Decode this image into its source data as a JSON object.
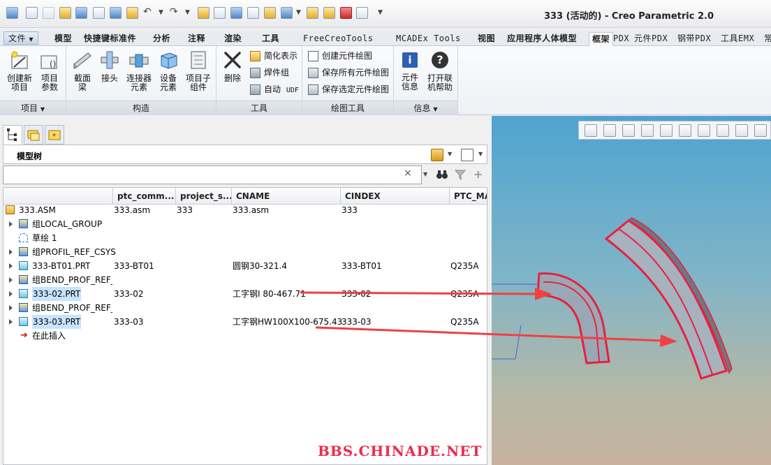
{
  "window": {
    "title": "333 (活动的) - Creo Parametric 2.0"
  },
  "menu_tabs": [
    {
      "label": "文件"
    },
    {
      "label": "模型"
    },
    {
      "label": "快捷键标准件"
    },
    {
      "label": "分析"
    },
    {
      "label": "注释"
    },
    {
      "label": "渲染"
    },
    {
      "label": "工具"
    },
    {
      "label": "FreeCreoTools"
    },
    {
      "label": "MCADEx Tools"
    },
    {
      "label": "视图"
    },
    {
      "label": "应用程序人体模型"
    },
    {
      "label": "框架"
    },
    {
      "label": "PDX"
    },
    {
      "label": "元件PDX"
    },
    {
      "label": "钢带PDX"
    },
    {
      "label": "工具EMX"
    },
    {
      "label": "常"
    }
  ],
  "ribbon": {
    "groups": [
      {
        "label": "项目"
      },
      {
        "label": "构造"
      },
      {
        "label": "工具"
      },
      {
        "label": "绘图工具"
      },
      {
        "label": "信息"
      }
    ],
    "project_buttons": [
      {
        "line1": "创建新",
        "line2": "项目"
      },
      {
        "line1": "项目",
        "line2": "参数"
      }
    ],
    "construct_buttons": [
      {
        "line1": "截面",
        "line2": "梁"
      },
      {
        "line1": "接头",
        "line2": ""
      },
      {
        "line1": "连接器",
        "line2": "元素"
      },
      {
        "line1": "设备",
        "line2": "元素"
      },
      {
        "line1": "项目子",
        "line2": "组件"
      }
    ],
    "delete_button": "删除",
    "tool_items": [
      "简化表示",
      "焊件组",
      "自动"
    ],
    "udf_tag": "UDF",
    "drawing_items": [
      "创建元件绘图",
      "保存所有元件绘图",
      "保存选定元件绘图"
    ],
    "info_buttons": [
      {
        "line1": "元件",
        "line2": "信息",
        "glyph": "i"
      },
      {
        "line1": "打开联",
        "line2": "机帮助",
        "glyph": "?"
      }
    ]
  },
  "tree": {
    "title": "模型树",
    "filter_placeholder": "",
    "clear_glyph": "×",
    "columns": [
      "",
      "ptc_comm...",
      "project_s...",
      "CNAME",
      "CINDEX",
      "PTC_MA"
    ],
    "rows": [
      {
        "name": "333.ASM",
        "c1": "333.asm",
        "c2": "333",
        "c3": "333.asm",
        "c4": "333",
        "c5": ""
      },
      {
        "name": "组LOCAL_GROUP",
        "c1": "",
        "c2": "",
        "c3": "",
        "c4": "",
        "c5": ""
      },
      {
        "name": "草绘 1",
        "c1": "",
        "c2": "",
        "c3": "",
        "c4": "",
        "c5": ""
      },
      {
        "name": "组PROFIL_REF_CSYS",
        "c1": "",
        "c2": "",
        "c3": "",
        "c4": "",
        "c5": ""
      },
      {
        "name": "333-BT01.PRT",
        "c1": "333-BT01",
        "c2": "",
        "c3": "圆钢30-321.4",
        "c4": "333-BT01",
        "c5": "Q235A"
      },
      {
        "name": "组BEND_PROF_REF_",
        "c1": "",
        "c2": "",
        "c3": "",
        "c4": "",
        "c5": ""
      },
      {
        "name": "333-02.PRT",
        "c1": "333-02",
        "c2": "",
        "c3": "工字钢I 80-467.71",
        "c4": "333-02",
        "c5": "Q235A"
      },
      {
        "name": "组BEND_PROF_REF_",
        "c1": "",
        "c2": "",
        "c3": "",
        "c4": "",
        "c5": ""
      },
      {
        "name": "333-03.PRT",
        "c1": "333-03",
        "c2": "",
        "c3": "工字钢HW100X100-675.43",
        "c4": "333-03",
        "c5": "Q235A"
      },
      {
        "name": "在此插入",
        "c1": "",
        "c2": "",
        "c3": "",
        "c4": "",
        "c5": ""
      }
    ]
  },
  "watermark": "BBS.CHINADE.NET",
  "colors": {
    "accent": "#e8203e",
    "selection": "#c8e3ff",
    "viewport_top": "#4fa3d0"
  }
}
